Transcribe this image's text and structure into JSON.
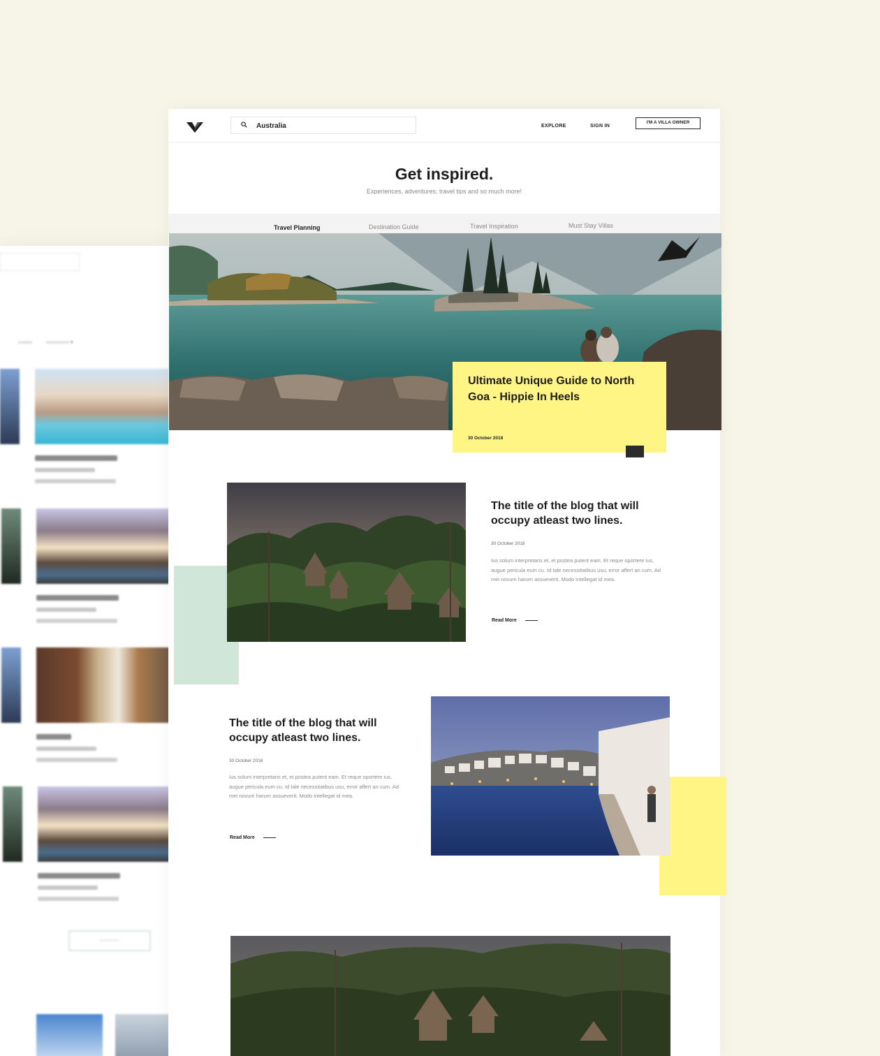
{
  "nav": {
    "search_value": "Australia",
    "explore": "EXPLORE",
    "sign_in": "SIGN IN",
    "owner_button": "I'M A VILLA OWNER"
  },
  "hero": {
    "title": "Get inspired.",
    "subtitle": "Experiences, adventures, travel tips and so much more!"
  },
  "tabs": [
    {
      "label": "Travel Planning",
      "active": true
    },
    {
      "label": "Destination Guide",
      "active": false
    },
    {
      "label": "Travel Inspiration",
      "active": false
    },
    {
      "label": "Must Stay Villas",
      "active": false
    }
  ],
  "featured": {
    "title": "Ultimate Unique Guide to North Goa - Hippie In Heels",
    "date": "30 October 2018"
  },
  "posts": [
    {
      "title": "The title of the blog that will occupy atleast two lines.",
      "date": "30 October 2018",
      "excerpt": "Ius solum interpretaris et, et postea putent eam. Et reque oportere ius, augue pericula eum cu. Id tale necessitatibus usu, error affert an cum. Ad mei novum harum assueverit. Modo intellegat id mea.",
      "read_more": "Read More"
    },
    {
      "title": "The title of the blog that will occupy atleast two lines.",
      "date": "30 October 2018",
      "excerpt": "Ius solum interpretaris et, et postea putent eam. Et reque oportere ius, augue pericula eum cu. Id tale necessitatibus usu, error affert an cum. Ad mei novum harum assueverit. Modo intellegat id mea.",
      "read_more": "Read More"
    }
  ],
  "colors": {
    "background": "#f7f5e7",
    "accent_yellow": "#fff584",
    "accent_mint": "#cfe6d9",
    "text_dark": "#1d1d1d"
  }
}
